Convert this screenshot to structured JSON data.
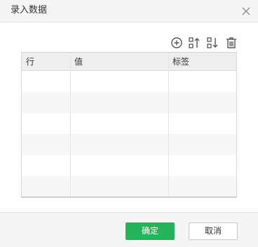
{
  "dialog": {
    "title": "录入数据"
  },
  "toolbar": {
    "icons": [
      "add-circle-icon",
      "sort-ascending-icon",
      "sort-descending-icon",
      "trash-icon"
    ]
  },
  "table": {
    "columns": [
      "行",
      "值",
      "标签"
    ],
    "rows": [
      [
        "",
        "",
        ""
      ],
      [
        "",
        "",
        ""
      ],
      [
        "",
        "",
        ""
      ],
      [
        "",
        "",
        ""
      ],
      [
        "",
        "",
        ""
      ],
      [
        "",
        "",
        ""
      ]
    ]
  },
  "footer": {
    "ok_label": "确定",
    "cancel_label": "取消"
  },
  "colors": {
    "primary": "#27b35c",
    "header_bg": "#f5f5f5",
    "grid_header_bg": "#eeeeee"
  }
}
